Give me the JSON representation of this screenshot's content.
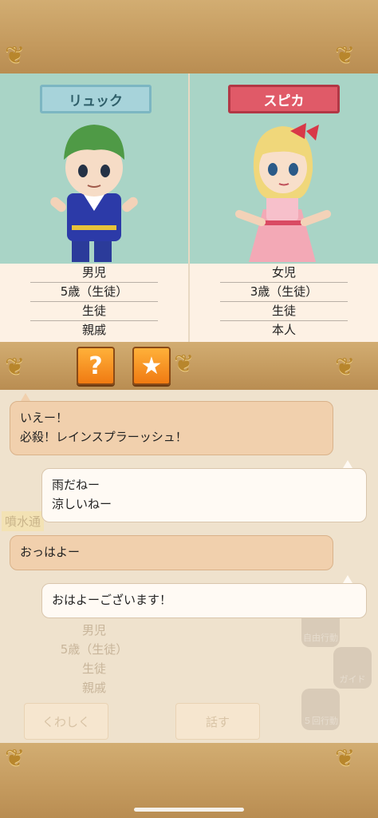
{
  "characters": [
    {
      "name": "リュック",
      "gender": "男児",
      "age": "5歳（生徒）",
      "role": "生徒",
      "relation": "親戚"
    },
    {
      "name": "スピカ",
      "gender": "女児",
      "age": "3歳（生徒）",
      "role": "生徒",
      "relation": "本人"
    }
  ],
  "buttons": {
    "help": "?",
    "favorite": "★"
  },
  "chat": [
    {
      "speaker": "left",
      "lines": [
        "いえー！",
        "必殺！レインスプラーッシュ！"
      ]
    },
    {
      "speaker": "right",
      "lines": [
        "雨だねー",
        "涼しいねー"
      ]
    },
    {
      "speaker": "left",
      "lines": [
        "おっはよー"
      ]
    },
    {
      "speaker": "right",
      "lines": [
        "おはよーございます！"
      ]
    }
  ],
  "background": {
    "location": "噴水通",
    "gender": "男児",
    "age": "5歳（生徒）",
    "role": "生徒",
    "relation": "親戚",
    "details_btn": "くわしく",
    "talk_btn": "話す",
    "hex_buttons": [
      "自由行動",
      "ガイド",
      "５回行動"
    ]
  },
  "colors": {
    "panel_bg": "#a9d4c6",
    "name_left": "#a7d3da",
    "name_right": "#e05a68",
    "accent_orange": "#f07a12"
  }
}
